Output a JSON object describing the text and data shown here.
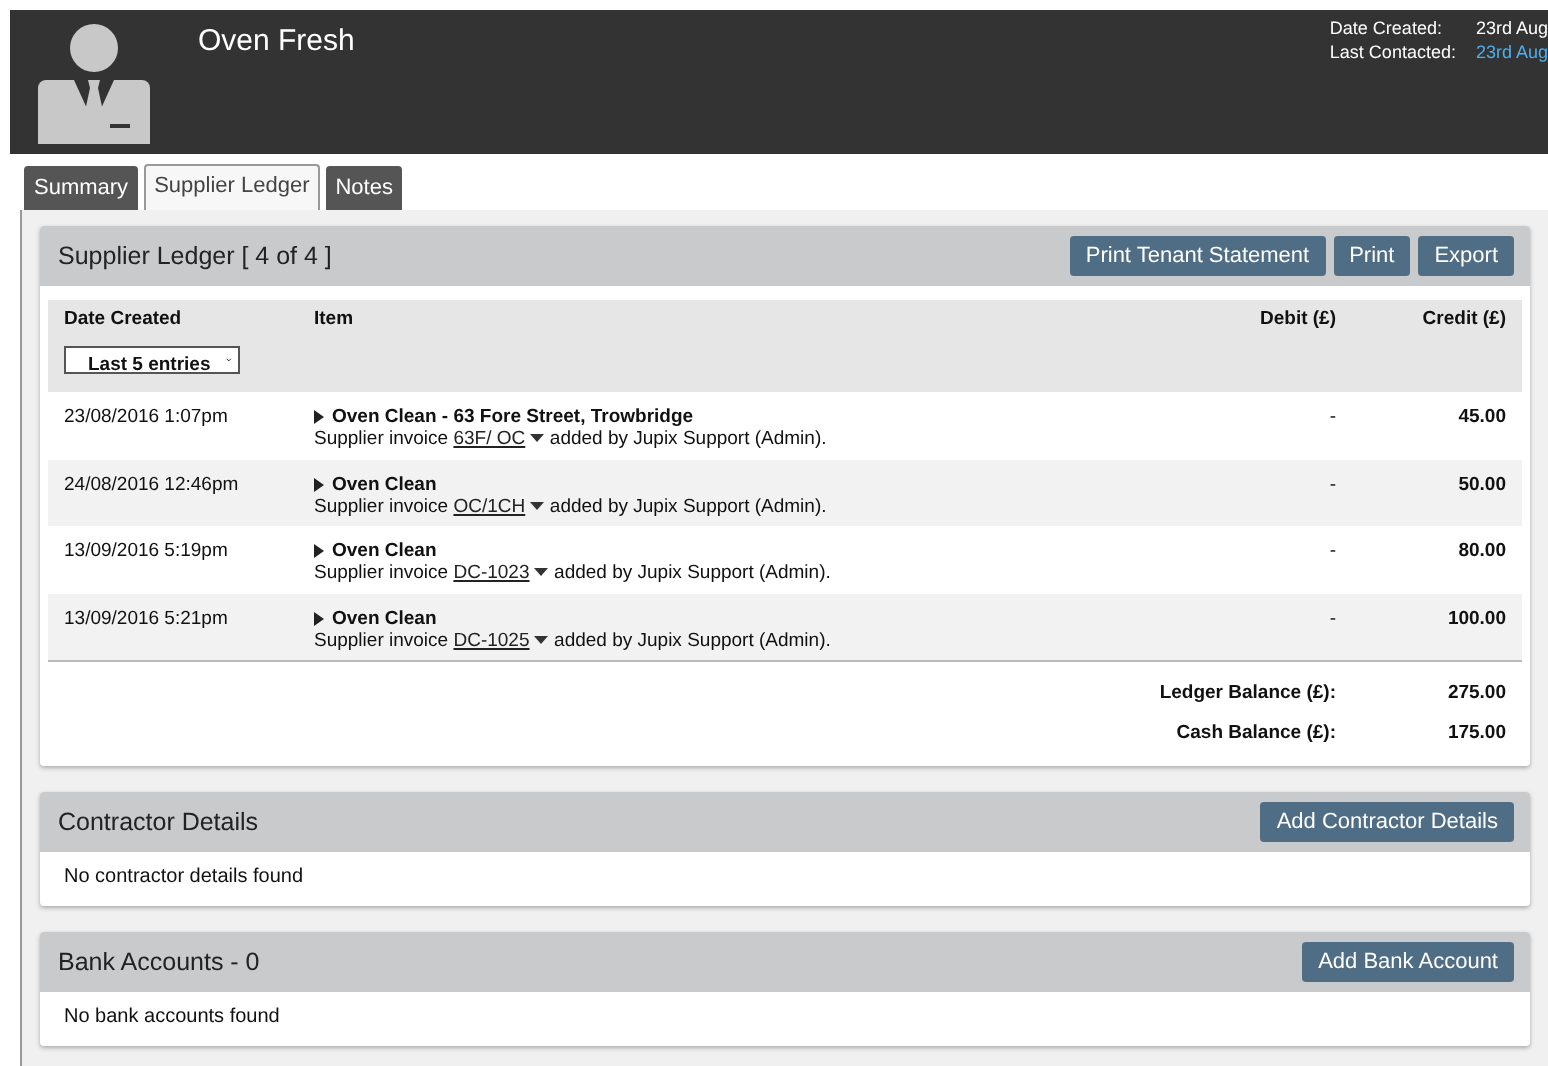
{
  "header": {
    "name": "Oven Fresh",
    "meta": [
      {
        "label": "Date Created:",
        "value": "23rd Aug",
        "kind": "plain"
      },
      {
        "label": "Last Contacted:",
        "value": "23rd Aug",
        "kind": "link"
      }
    ]
  },
  "tabs": [
    {
      "label": "Summary",
      "selected": false
    },
    {
      "label": "Supplier Ledger",
      "selected": true
    },
    {
      "label": "Notes",
      "selected": false
    }
  ],
  "ledger": {
    "title": "Supplier Ledger [ 4 of 4 ]",
    "buttons": [
      "Print Tenant Statement",
      "Print",
      "Export"
    ],
    "columns": [
      "Date Created",
      "Item",
      "Debit (£)",
      "Credit (£)"
    ],
    "filter": {
      "value": "Last 5 entries"
    },
    "rows": [
      {
        "date": "23/08/2016 1:07pm",
        "item": "Oven Clean - 63 Fore Street, Trowbridge",
        "prefix": "Supplier invoice",
        "ref": "63F/ OC",
        "suffix": "added by Jupix Support (Admin).",
        "debit": "-",
        "credit": "45.00"
      },
      {
        "date": "24/08/2016 12:46pm",
        "item": "Oven Clean",
        "prefix": "Supplier invoice",
        "ref": "OC/1CH",
        "suffix": "added by Jupix Support (Admin).",
        "debit": "-",
        "credit": "50.00"
      },
      {
        "date": "13/09/2016 5:19pm",
        "item": "Oven Clean",
        "prefix": "Supplier invoice",
        "ref": "DC-1023",
        "suffix": "added by Jupix Support (Admin).",
        "debit": "-",
        "credit": "80.00"
      },
      {
        "date": "13/09/2016 5:21pm",
        "item": "Oven Clean",
        "prefix": "Supplier invoice",
        "ref": "DC-1025",
        "suffix": "added by Jupix Support (Admin).",
        "debit": "-",
        "credit": "100.00"
      }
    ],
    "totals": [
      {
        "label": "Ledger Balance (£):",
        "value": "275.00"
      },
      {
        "label": "Cash Balance (£):",
        "value": "175.00"
      }
    ]
  },
  "panels": [
    {
      "title": "Contractor Details",
      "button": "Add Contractor Details",
      "empty": "No contractor details found"
    },
    {
      "title": "Bank Accounts - 0",
      "button": "Add Bank Account",
      "empty": "No bank accounts found"
    }
  ]
}
